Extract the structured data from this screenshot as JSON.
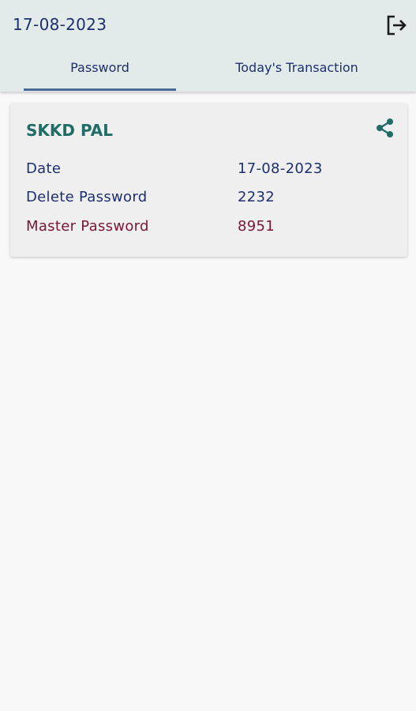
{
  "header": {
    "date": "17-08-2023",
    "logout_icon": "logout-icon"
  },
  "tabs": [
    {
      "label": "Password",
      "active": true
    },
    {
      "label": "Today's Transaction",
      "active": false
    }
  ],
  "card": {
    "name": "SKKD PAL",
    "share_icon": "share-icon",
    "rows": [
      {
        "label": "Date",
        "value": "17-08-2023"
      },
      {
        "label": "Delete Password",
        "value": "2232"
      },
      {
        "label": "Master Password",
        "value": "8951"
      }
    ]
  },
  "colors": {
    "header_bg": "#e2ebea",
    "primary_text": "#1d2f6f",
    "accent_teal": "#1f6d66",
    "master_password": "#7a1535"
  }
}
